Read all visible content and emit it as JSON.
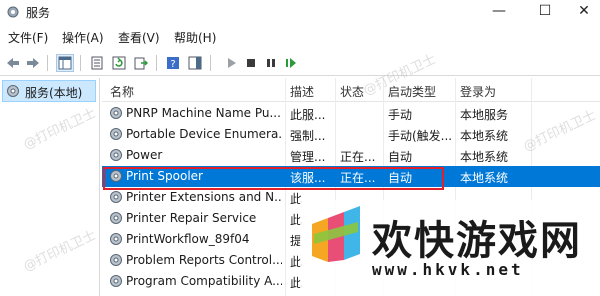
{
  "window": {
    "title": "服务",
    "min": "—",
    "max": "☐",
    "close": "✕"
  },
  "menu": [
    "文件(F)",
    "操作(A)",
    "查看(V)",
    "帮助(H)"
  ],
  "tree": {
    "label": "服务(本地)"
  },
  "table": {
    "headers": [
      "名称",
      "描述",
      "状态",
      "启动类型",
      "登录为"
    ],
    "rows": [
      [
        "PNRP Machine Name Pu...",
        "此服...",
        "",
        "手动",
        "本地服务"
      ],
      [
        "Portable Device Enumera...",
        "强制...",
        "",
        "手动(触发...",
        "本地系统"
      ],
      [
        "Power",
        "管理...",
        "正在...",
        "自动",
        "本地系统"
      ],
      [
        "Print Spooler",
        "该服...",
        "正在...",
        "自动",
        "本地系统"
      ],
      [
        "Printer Extensions and N...",
        "此",
        "",
        "",
        ""
      ],
      [
        "Printer Repair Service",
        "此",
        "",
        "",
        ""
      ],
      [
        "PrintWorkflow_89f04",
        "提",
        "",
        "",
        ""
      ],
      [
        "Problem Reports Control...",
        "此",
        "",
        "",
        ""
      ],
      [
        "Program Compatibility A...",
        "此",
        "",
        "",
        ""
      ]
    ],
    "selected_index": 3
  },
  "watermarks": [
    "@打印机卫士",
    "@打印机卫士",
    "@打印机卫士",
    "@打印机卫士"
  ],
  "brand": {
    "text": "欢快游戏网",
    "url": "www.hkvk.net"
  },
  "colors": {
    "selection": "#0078d7",
    "highlight_border": "#e0202a",
    "tree_selected": "#cce8ff"
  }
}
